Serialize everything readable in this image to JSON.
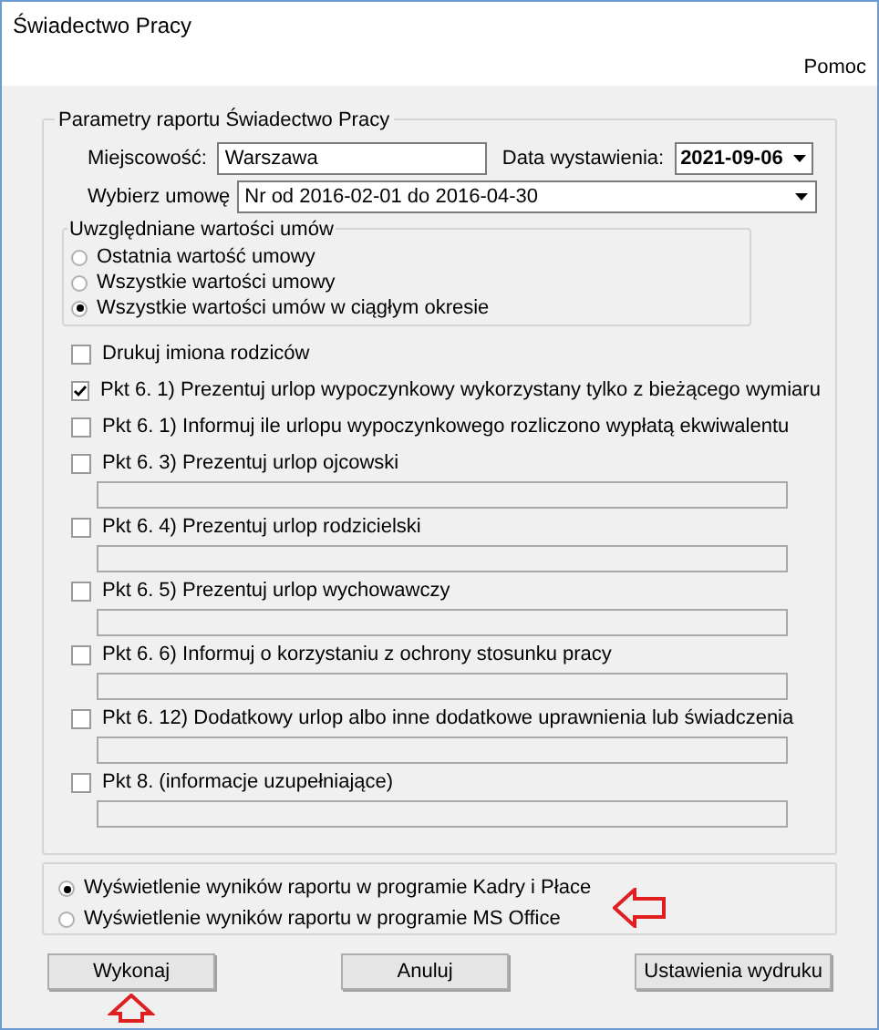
{
  "window": {
    "title": "Świadectwo Pracy"
  },
  "menu": [
    "Pomoc"
  ],
  "group": {
    "title": "Parametry raportu  Świadectwo Pracy",
    "city": {
      "label": "Miejscowość:",
      "value": "Warszawa"
    },
    "date": {
      "label": "Data wystawienia:",
      "value": "2021-09-06"
    },
    "contract": {
      "label": "Wybierz umowę",
      "value": "Nr  od 2016-02-01 do 2016-04-30"
    },
    "values_group": {
      "title": "Uwzględniane wartości umów",
      "options": [
        {
          "label": "Ostatnia wartość umowy",
          "selected": false
        },
        {
          "label": "Wszystkie wartości umowy",
          "selected": false
        },
        {
          "label": "Wszystkie wartości umów w ciągłym okresie",
          "selected": true
        }
      ]
    },
    "options": [
      {
        "label": "Drukuj imiona rodziców",
        "checked": false,
        "with_field": false
      },
      {
        "label": "Pkt 6. 1) Prezentuj urlop wypoczynkowy wykorzystany tylko z bieżącego wymiaru",
        "checked": true,
        "with_field": false
      },
      {
        "label": "Pkt 6. 1) Informuj ile urlopu wypoczynkowego rozliczono wypłatą ekwiwalentu",
        "checked": false,
        "with_field": false
      },
      {
        "label": "Pkt 6. 3) Prezentuj urlop ojcowski",
        "checked": false,
        "with_field": true
      },
      {
        "label": "Pkt 6. 4) Prezentuj urlop rodzicielski",
        "checked": false,
        "with_field": true
      },
      {
        "label": "Pkt 6. 5) Prezentuj urlop wychowawczy",
        "checked": false,
        "with_field": true
      },
      {
        "label": "Pkt 6. 6) Informuj o korzystaniu z ochrony stosunku pracy",
        "checked": false,
        "with_field": true
      },
      {
        "label": "Pkt 6. 12) Dodatkowy urlop albo inne dodatkowe uprawnienia lub świadczenia",
        "checked": false,
        "with_field": true
      },
      {
        "label": "Pkt 8. (informacje uzupełniające)",
        "checked": false,
        "with_field": true
      }
    ]
  },
  "output": [
    {
      "label": "Wyświetlenie wyników raportu w programie Kadry i Płace",
      "selected": true
    },
    {
      "label": "Wyświetlenie wyników raportu w programie MS Office",
      "selected": false
    }
  ],
  "buttons": [
    "Wykonaj",
    "Anuluj",
    "Ustawienia wydruku"
  ]
}
